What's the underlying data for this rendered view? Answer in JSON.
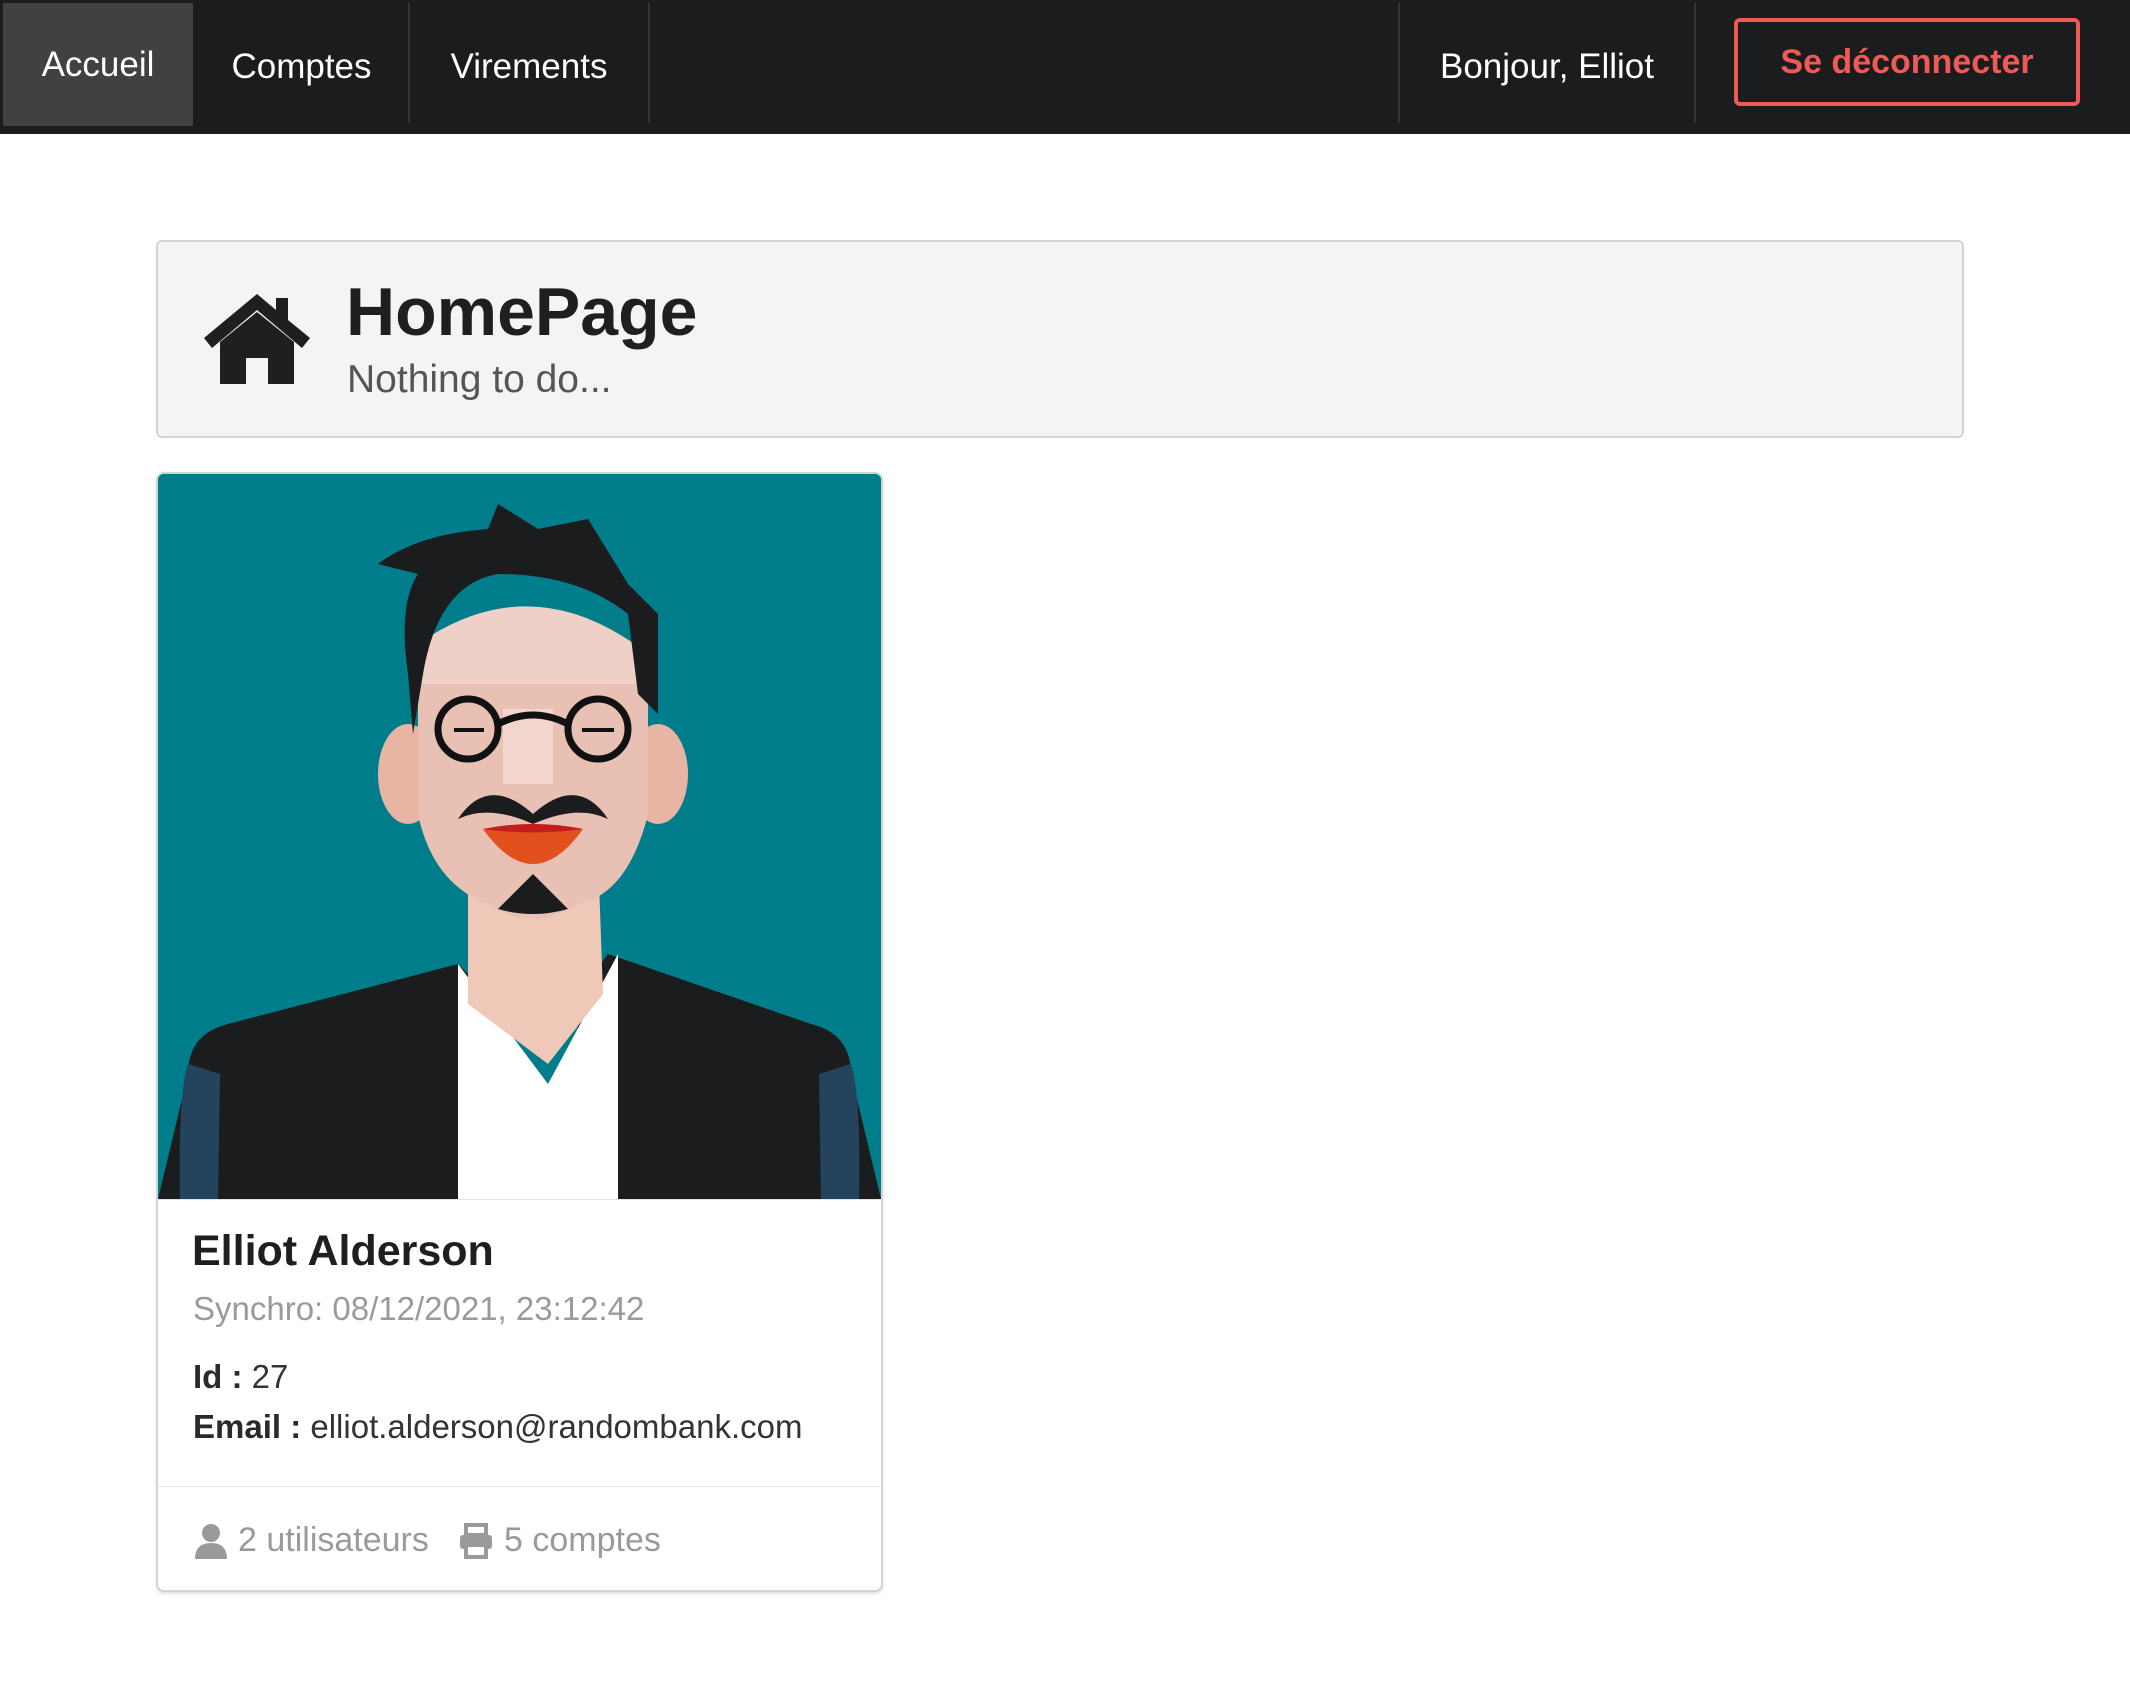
{
  "nav": {
    "items": [
      {
        "label": "Accueil",
        "active": true
      },
      {
        "label": "Comptes",
        "active": false
      },
      {
        "label": "Virements",
        "active": false
      }
    ],
    "greeting": "Bonjour, Elliot",
    "logout_label": "Se déconnecter"
  },
  "header": {
    "icon": "home-icon",
    "title": "HomePage",
    "subtitle": "Nothing to do..."
  },
  "profile": {
    "name": "Elliot Alderson",
    "synchro": "Synchro: 08/12/2021, 23:12:42",
    "id_label": "Id :",
    "id_value": "27",
    "email_label": "Email :",
    "email_value": "elliot.alderson@randombank.com",
    "users_icon": "user-icon",
    "users_count": "2 utilisateurs",
    "accounts_icon": "print-icon",
    "accounts_count": "5 comptes"
  },
  "colors": {
    "topbar": "#1b1c1d",
    "logout": "#ef5a57",
    "avatar_bg": "#007d8a"
  }
}
